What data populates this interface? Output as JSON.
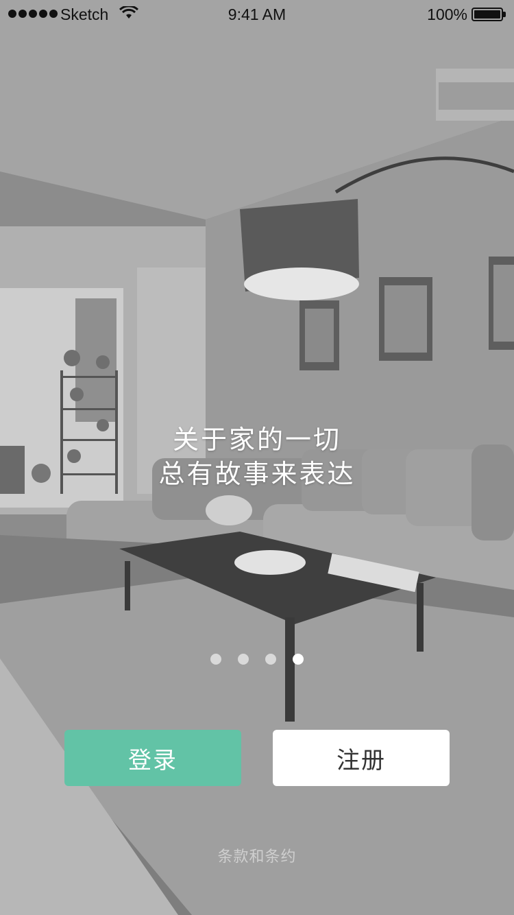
{
  "status_bar": {
    "carrier": "Sketch",
    "time": "9:41 AM",
    "battery": "100%"
  },
  "headline": {
    "line1": "关于家的一切",
    "line2": "总有故事来表达"
  },
  "pager": {
    "count": 4,
    "active_index": 3
  },
  "buttons": {
    "login": "登录",
    "register": "注册"
  },
  "terms": "条款和条约",
  "colors": {
    "accent": "#62c3a6",
    "overlay": "#8a8a8a",
    "button_light": "#ffffff"
  }
}
